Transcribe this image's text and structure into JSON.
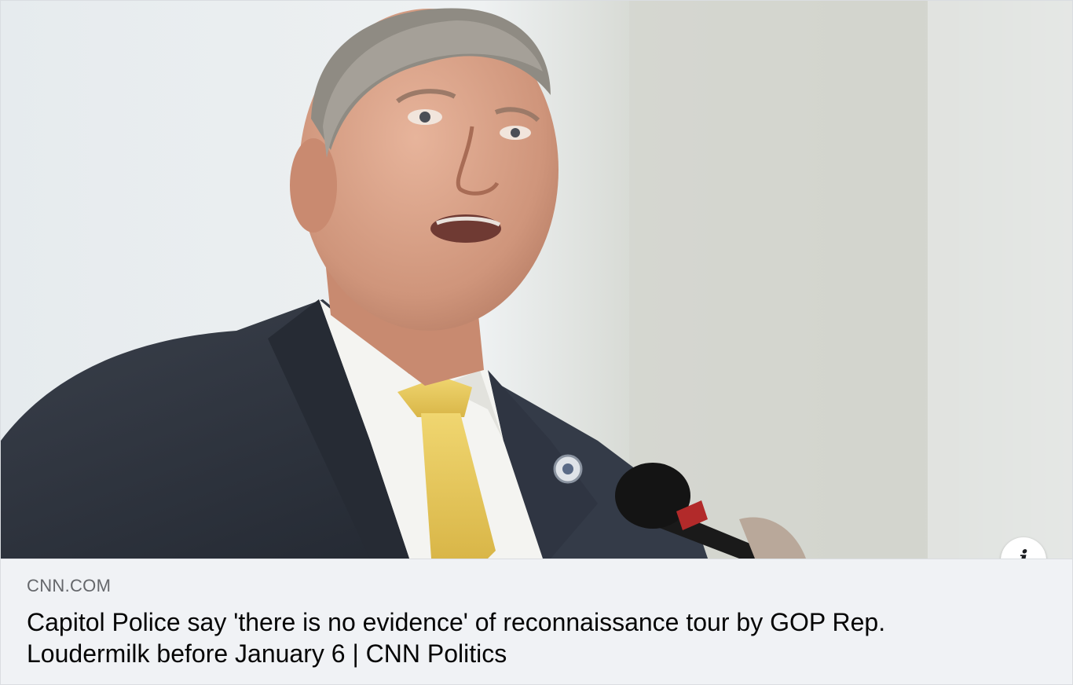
{
  "link_preview": {
    "image_alt": "Man in dark suit and yellow tie speaking at a microphone",
    "domain": "CNN.COM",
    "headline": "Capitol Police say 'there is no evidence' of reconnaissance tour by GOP Rep. Loudermilk before January 6 | CNN Politics",
    "info_icon": "info-icon"
  },
  "colors": {
    "card_background": "#f0f2f5",
    "domain_text": "#65676b",
    "headline_text": "#050505",
    "suit": "#2b313c",
    "tie": "#e8c85a",
    "shirt": "#f4f4f1"
  }
}
